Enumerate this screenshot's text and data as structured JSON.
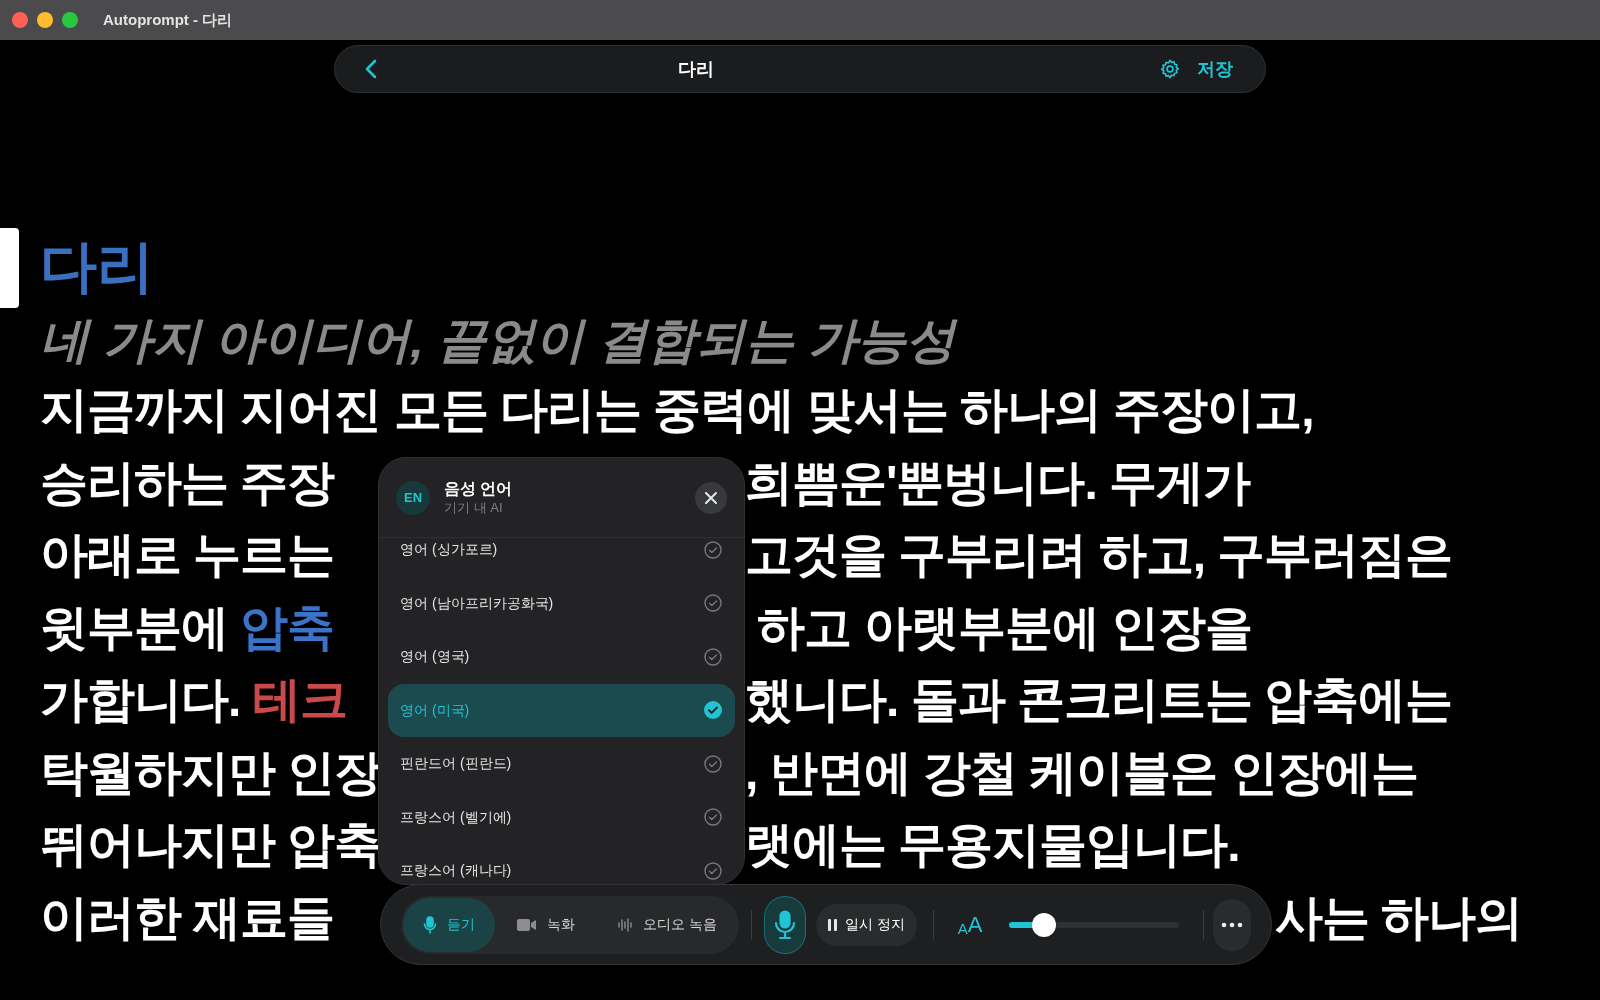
{
  "window": {
    "title": "Autoprompt - 다리"
  },
  "nav": {
    "title": "다리",
    "save": "저장"
  },
  "document": {
    "title": "다리",
    "subtitle": "네 가지 아이디어, 끝없이 결합되는 가능성",
    "lines": [
      {
        "left": [
          {
            "text": "지금까지 지어진 모든 다리는 중력에 맞서는 하나의 주장이고,"
          }
        ]
      }
    ],
    "lines_beside_popup": [
      {
        "left": [
          {
            "text": "승리하는 주장"
          }
        ],
        "right": [
          {
            "text": "희쁨운'뿐벙니다. 무게가"
          }
        ]
      },
      {
        "left": [
          {
            "text": "아래로 누르는"
          }
        ],
        "right": [
          {
            "text": "고것을 구부리려 하고, 구부러짐은"
          }
        ]
      },
      {
        "left": [
          {
            "text": "윗부분에 "
          },
          {
            "text": "압축",
            "color": "#3b73c6"
          }
        ],
        "right": [
          {
            "text": " 하고 아랫부분에 인장을"
          }
        ]
      },
      {
        "left": [
          {
            "text": "가합니다. "
          },
          {
            "text": "테크",
            "color": "#c94a4a"
          }
        ],
        "right": [
          {
            "text": "했니다. 돌과 콘크리트는 압축에는"
          }
        ]
      },
      {
        "left": [
          {
            "text": "탁월하지만 인장"
          }
        ],
        "right": [
          {
            "text": ", 반면에 강철 케이블은 인장에는"
          }
        ]
      },
      {
        "left": [
          {
            "text": "뛰어나지만 압축"
          }
        ],
        "right": [
          {
            "text": "랫에는 무용지물입니다."
          }
        ]
      }
    ],
    "lines_beside_toolbar": [
      {
        "left": [
          {
            "text": "이러한 재료들"
          }
        ],
        "right": [
          {
            "text": "사는 하나의"
          }
        ]
      }
    ]
  },
  "language_popup": {
    "badge": "EN",
    "title": "음성 언어",
    "subtitle": "기기 내 AI",
    "items": [
      {
        "label": "영어 (싱가포르)",
        "selected": false
      },
      {
        "label": "영어 (남아프리카공화국)",
        "selected": false
      },
      {
        "label": "영어 (영국)",
        "selected": false
      },
      {
        "label": "영어 (미국)",
        "selected": true
      },
      {
        "label": "핀란드어 (핀란드)",
        "selected": false
      },
      {
        "label": "프랑스어 (벨기에)",
        "selected": false
      },
      {
        "label": "프랑스어 (캐나다)",
        "selected": false
      }
    ]
  },
  "toolbar": {
    "modes": [
      {
        "kind": "listen",
        "label": "듣기",
        "selected": true
      },
      {
        "kind": "video",
        "label": "녹화",
        "selected": false
      },
      {
        "kind": "audio",
        "label": "오디오 녹음",
        "selected": false
      }
    ],
    "pause": "일시 정지",
    "font_size_label": "AA",
    "font_size": {
      "level": 0.16
    }
  }
}
